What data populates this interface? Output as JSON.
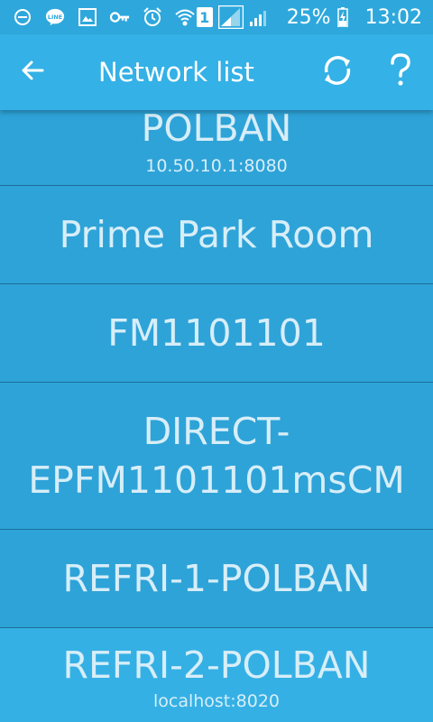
{
  "status_bar": {
    "battery": "25%",
    "time": "13:02",
    "sim": "1"
  },
  "app_bar": {
    "title": "Network list"
  },
  "networks": [
    {
      "name": "POLBAN",
      "sub": "10.50.10.1:8080"
    },
    {
      "name": "Prime Park Room",
      "sub": ""
    },
    {
      "name": "FM1101101",
      "sub": ""
    },
    {
      "name": "DIRECT-EPFM1101101msCM",
      "name_line1": "DIRECT-",
      "name_line2": "EPFM1101101msCM",
      "sub": ""
    },
    {
      "name": "REFRI-1-POLBAN",
      "sub": ""
    },
    {
      "name": "REFRI-2-POLBAN",
      "sub": "localhost:8020"
    }
  ],
  "colors": {
    "status_bar": "#2ea8dc",
    "app_bar": "#34b1e6",
    "list_bg": "#2ea3d8",
    "list_text": "#d7eef8",
    "divider": "#1b6e97"
  }
}
